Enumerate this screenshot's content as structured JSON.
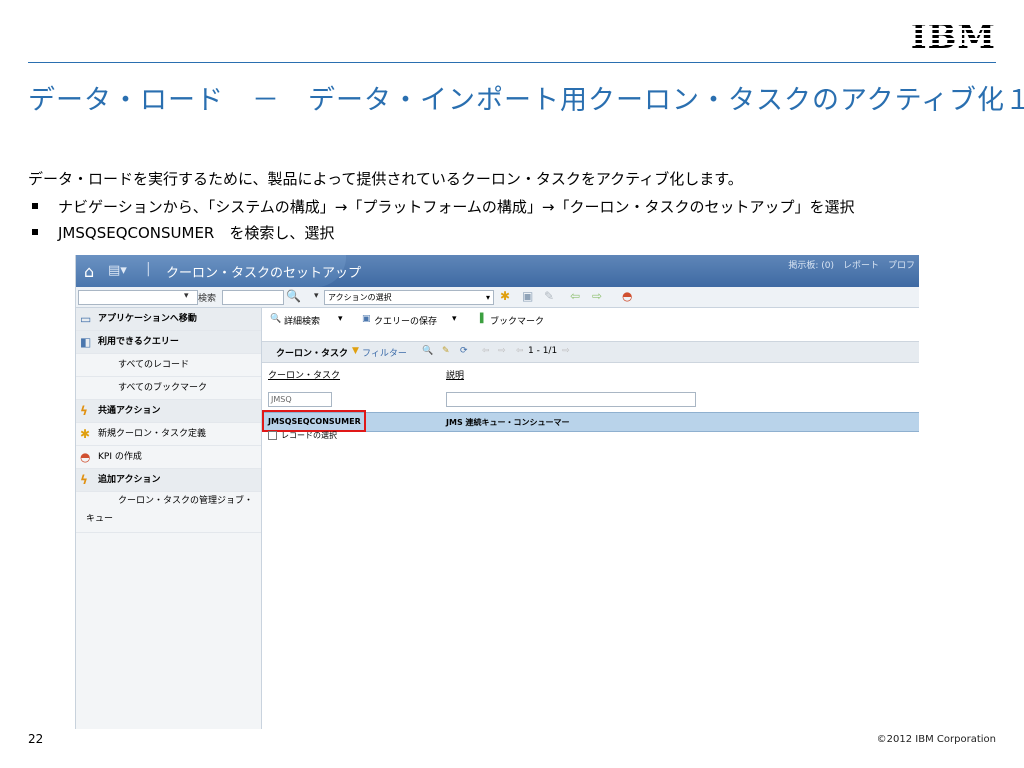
{
  "slide": {
    "logo": "IBM",
    "title": "データ・ロード　－　データ・インポート用クーロン・タスクのアクティブ化１",
    "intro": "データ・ロードを実行するために、製品によって提供されているクーロン・タスクをアクティブ化します。",
    "bullets": [
      "ナビゲーションから、「システムの構成」→「プラットフォームの構成」→「クーロン・タスクのセットアップ」を選択",
      "JMSQSEQCONSUMER　を検索し、選択"
    ],
    "page_number": "22",
    "copyright": "©2012 IBM Corporation"
  },
  "app": {
    "title": "クーロン・タスクのセットアップ",
    "header_links": "掲示板: (0)　レポート　プロフ",
    "toolbar": {
      "search_label": "検索",
      "action_select": "アクションの選択"
    },
    "sidebar": {
      "items": [
        {
          "label": "アプリケーションへ移動",
          "icon": "app-icon"
        },
        {
          "label": "利用できるクエリー",
          "icon": "query-icon"
        },
        {
          "label": "すべてのレコード"
        },
        {
          "label": "すべてのブックマーク"
        },
        {
          "label": "共通アクション",
          "icon": "lightning-icon"
        },
        {
          "label": "新規クーロン・タスク定義",
          "icon": "new-icon"
        },
        {
          "label": "KPI の作成",
          "icon": "kpi-icon"
        },
        {
          "label": "追加アクション",
          "icon": "lightning-icon"
        },
        {
          "label": "クーロン・タスクの管理ジョブ・キュー"
        }
      ]
    },
    "main": {
      "advanced_search": "詳細検索",
      "save_query": "クエリーの保存",
      "bookmark": "ブックマーク",
      "list_title": "クーロン・タスク",
      "filter_label": "フィルター",
      "pager": "1 - 1/1",
      "columns": [
        "クーロン・タスク",
        "説明"
      ],
      "filter_value": "JMSQ",
      "rows": [
        {
          "name": "JMSQSEQCONSUMER",
          "description": "JMS 連続キュー・コンシューマー"
        }
      ],
      "select_records": "レコードの選択"
    },
    "colors": {
      "accent": "#2a6fb0",
      "header": "#4a76ad",
      "selected_row": "#b9d3ea",
      "highlight": "#e01818"
    }
  }
}
